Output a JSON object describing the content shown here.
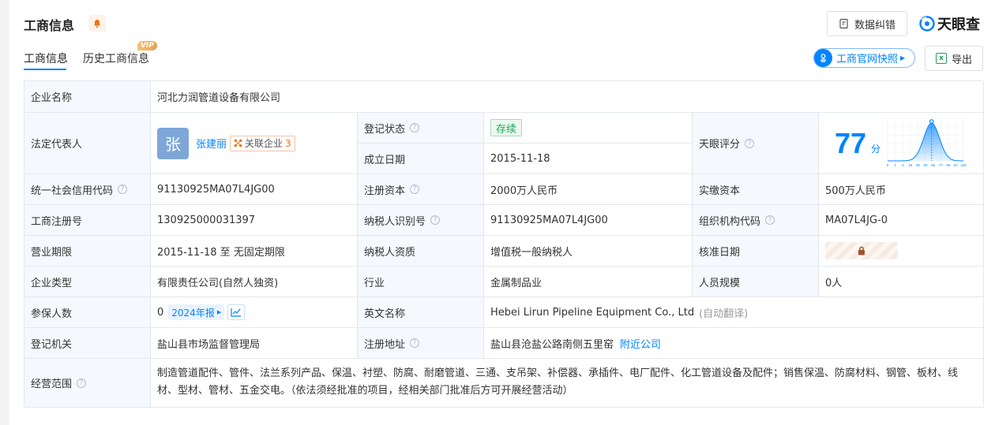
{
  "header": {
    "title": "工商信息",
    "correct_button": "数据纠错",
    "logo_text": "天眼查",
    "accent_color": "#0084ff"
  },
  "tabs": [
    {
      "label": "工商信息",
      "active": true
    },
    {
      "label": "历史工商信息",
      "badge": "VIP"
    }
  ],
  "actions": {
    "snapshot": "工商官网快照",
    "export": "导出",
    "export_icon_text": "x"
  },
  "table": {
    "company_name_label": "企业名称",
    "company_name": "河北力润管道设备有限公司",
    "legal_rep_label": "法定代表人",
    "legal_rep_avatar": "张",
    "legal_rep_name": "张建丽",
    "assoc_label": "关联企业",
    "assoc_count": "3",
    "reg_status_label": "登记状态",
    "reg_status": "存续",
    "founded_label": "成立日期",
    "founded": "2015-11-18",
    "score_label": "天眼评分",
    "score": "77",
    "score_unit": "分",
    "credit_code_label": "统一社会信用代码",
    "credit_code": "91130925MA07L4JG00",
    "reg_capital_label": "注册资本",
    "reg_capital": "2000万人民币",
    "paid_capital_label": "实缴资本",
    "paid_capital": "500万人民币",
    "reg_no_label": "工商注册号",
    "reg_no": "130925000031397",
    "taxpayer_id_label": "纳税人识别号",
    "taxpayer_id": "91130925MA07L4JG00",
    "org_code_label": "组织机构代码",
    "org_code": "MA07L4JG-0",
    "term_label": "营业期限",
    "term": "2015-11-18 至 无固定期限",
    "taxpayer_qual_label": "纳税人资质",
    "taxpayer_qual": "增值税一般纳税人",
    "approval_date_label": "核准日期",
    "company_type_label": "企业类型",
    "company_type": "有限责任公司(自然人独资)",
    "industry_label": "行业",
    "industry": "金属制品业",
    "staff_label": "人员规模",
    "staff": "0人",
    "insured_label": "参保人数",
    "insured": "0",
    "report_year": "2024年报",
    "english_name_label": "英文名称",
    "english_name": "Hebei Lirun Pipeline Equipment Co., Ltd",
    "auto_translate": "(自动翻译)",
    "authority_label": "登记机关",
    "authority": "盐山县市场监督管理局",
    "address_label": "注册地址",
    "address": "盐山县沧盐公路南侧五里窑",
    "nearby": "附近公司",
    "scope_label": "经营范围",
    "scope": "制造管道配件、管件、法兰系列产品、保温、衬塑、防腐、耐磨管道、三通、支吊架、补偿器、承插件、电厂配件、化工管道设备及配件；销售保温、防腐材料、钢管、板材、线材、型材、管材、五金交电。（依法须经批准的项目，经相关部门批准后方可开展经营活动）"
  },
  "chart_data": {
    "type": "area",
    "x_ticks": [
      "0",
      "1",
      "3",
      "15",
      "35",
      "50",
      "65",
      "77",
      "85",
      "97",
      "100"
    ],
    "marker": 77
  }
}
